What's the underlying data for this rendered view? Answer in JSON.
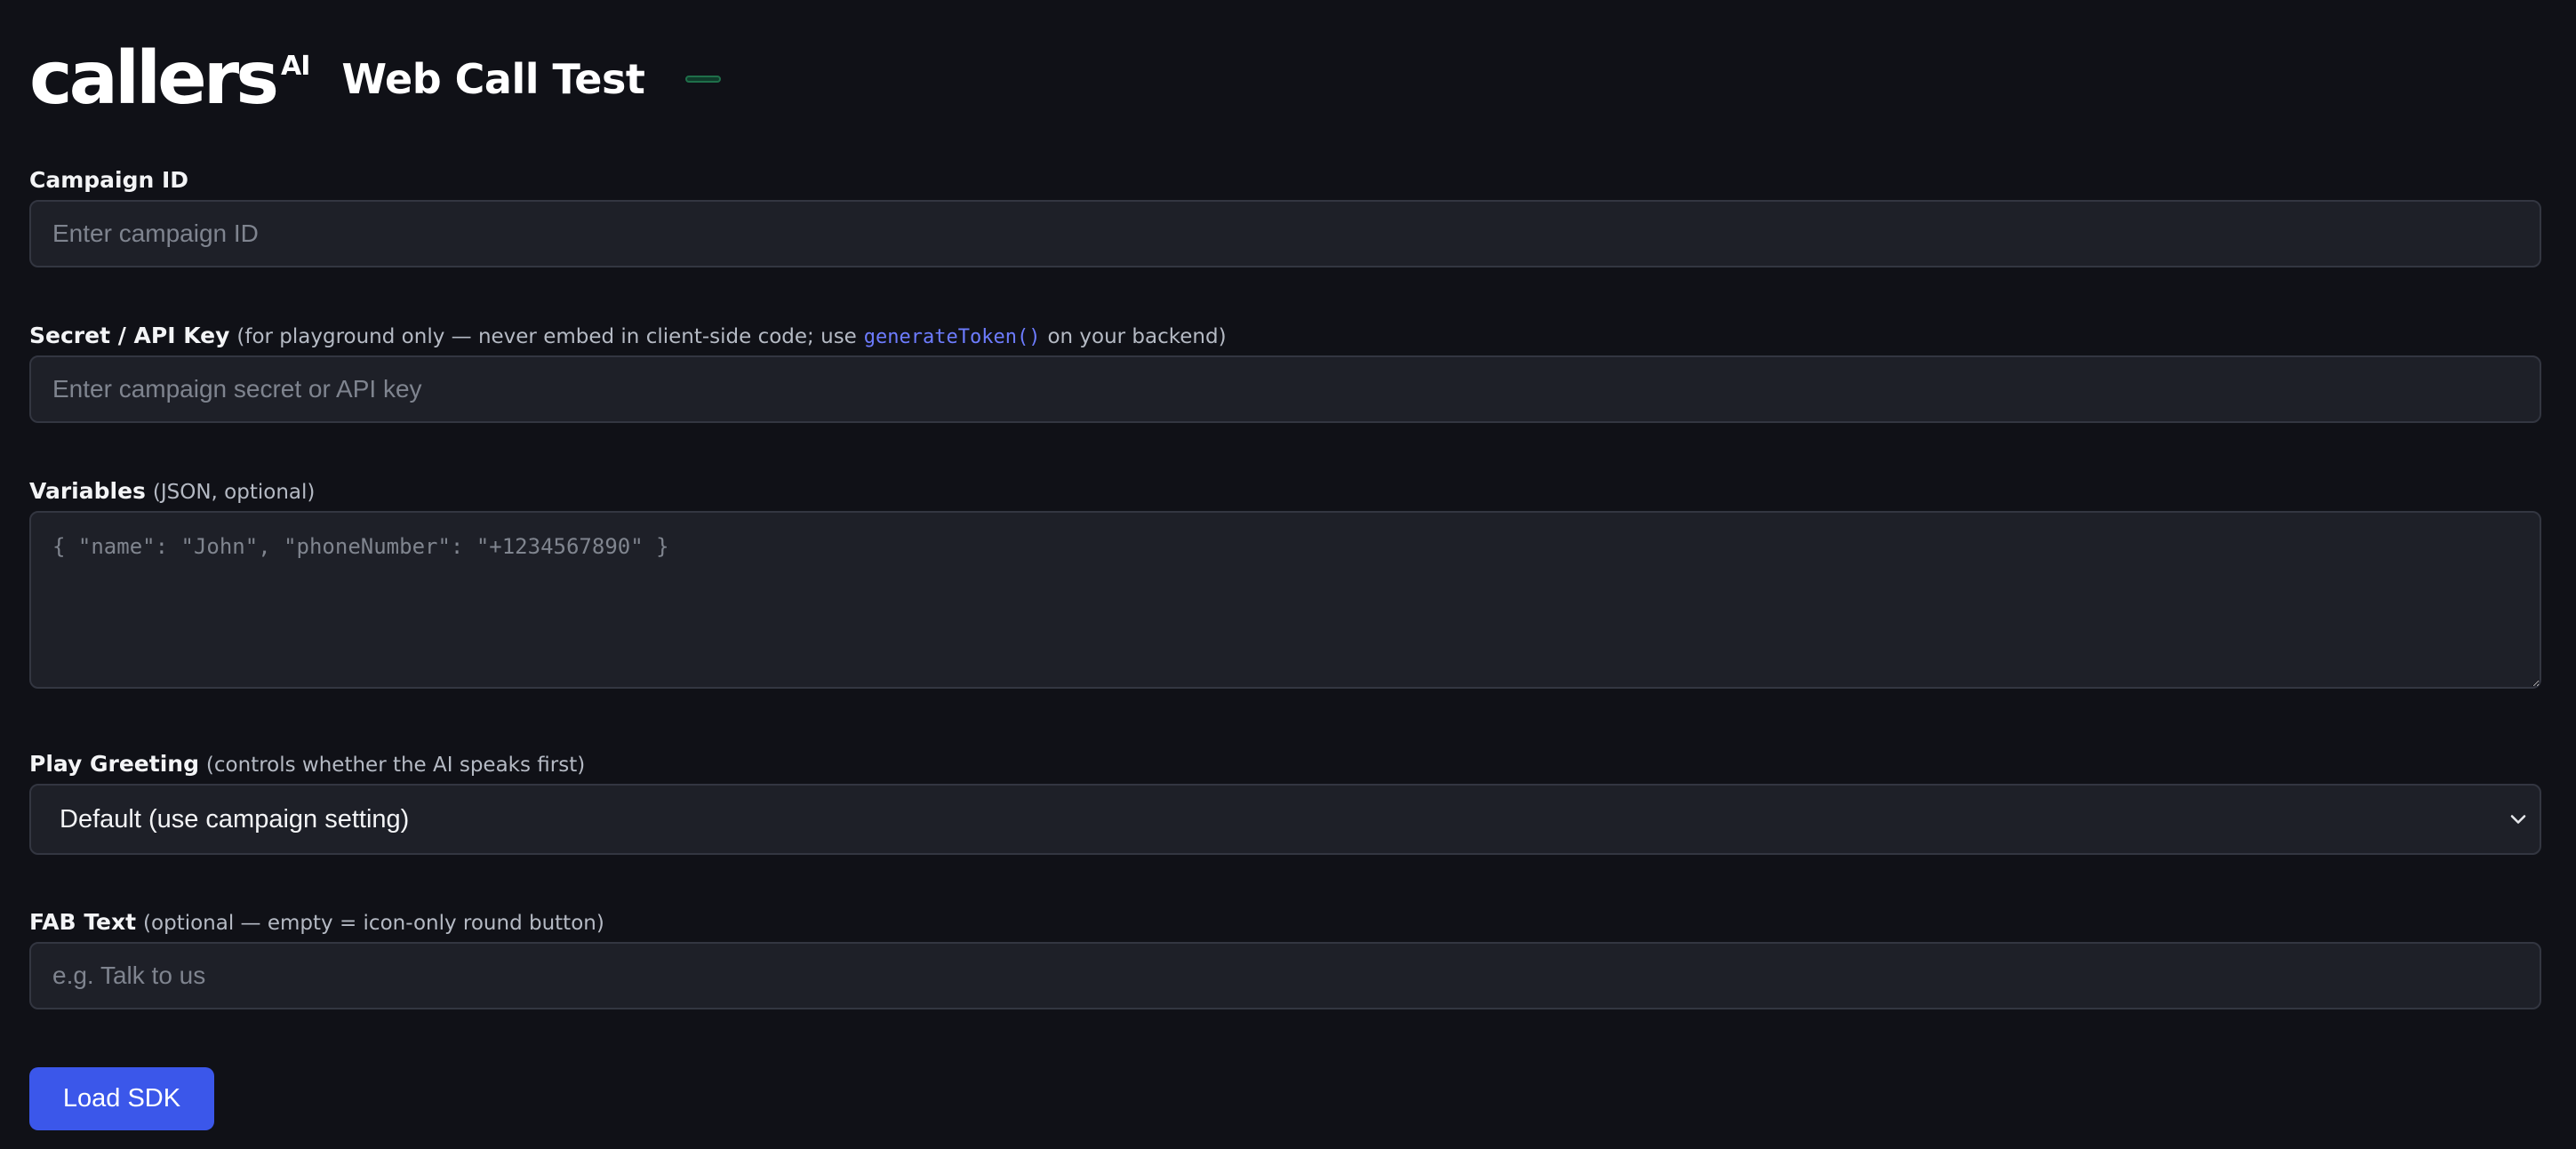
{
  "header": {
    "logo_word": "callers",
    "logo_sup": "AI",
    "title": "Web Call Test"
  },
  "form": {
    "campaign_id": {
      "label": "Campaign ID",
      "placeholder": "Enter campaign ID",
      "value": ""
    },
    "secret": {
      "label": "Secret / API Key",
      "hint_before": "(for playground only — never embed in client-side code; use",
      "hint_code": "generateToken()",
      "hint_after": "on your backend)",
      "placeholder": "Enter campaign secret or API key",
      "value": ""
    },
    "variables": {
      "label": "Variables",
      "hint": "(JSON, optional)",
      "placeholder": "{ \"name\": \"John\", \"phoneNumber\": \"+1234567890\" }",
      "value": ""
    },
    "play_greeting": {
      "label": "Play Greeting",
      "hint": "(controls whether the AI speaks first)",
      "selected": "Default (use campaign setting)"
    },
    "fab_text": {
      "label": "FAB Text",
      "hint": "(optional — empty = icon-only round button)",
      "placeholder": "e.g. Talk to us",
      "value": ""
    }
  },
  "actions": {
    "load_label": "Load SDK"
  },
  "colors": {
    "background": "#101117",
    "input_background": "#1e2028",
    "accent": "#3b57ea",
    "code": "#6d7cff",
    "status": "#1f6f4a"
  },
  "icons": {
    "select_chevron": "chevron-down-icon"
  }
}
